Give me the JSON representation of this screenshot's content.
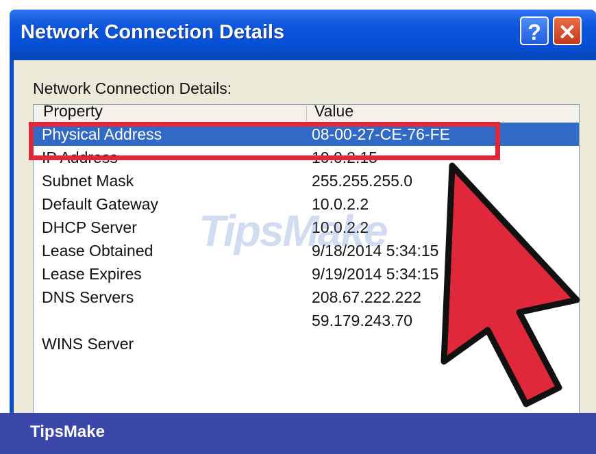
{
  "window": {
    "title": "Network Connection Details",
    "help_glyph": "?",
    "close_glyph": "✕"
  },
  "group_label": "Network Connection Details:",
  "columns": {
    "property": "Property",
    "value": "Value"
  },
  "rows": [
    {
      "property": "Physical Address",
      "value": "08-00-27-CE-76-FE"
    },
    {
      "property": "IP Address",
      "value": "10.0.2.15"
    },
    {
      "property": "Subnet Mask",
      "value": "255.255.255.0"
    },
    {
      "property": "Default Gateway",
      "value": "10.0.2.2"
    },
    {
      "property": "DHCP Server",
      "value": "10.0.2.2"
    },
    {
      "property": "Lease Obtained",
      "value": "9/18/2014 5:34:15"
    },
    {
      "property": "Lease Expires",
      "value": "9/19/2014 5:34:15"
    },
    {
      "property": "DNS Servers",
      "value": "208.67.222.222"
    },
    {
      "property": "",
      "value": "59.179.243.70"
    },
    {
      "property": "WINS Server",
      "value": ""
    }
  ],
  "watermark": "TipsMake",
  "footer": {
    "brand": "TipsMake"
  },
  "colors": {
    "titlebar": "#0650d6",
    "selection": "#3169c6",
    "highlight_box": "#e0283a",
    "arrow": "#e0283a",
    "footer": "#3a46a8"
  },
  "icons": {
    "help": "help-icon",
    "close": "close-icon",
    "pointer": "arrow-pointer"
  }
}
